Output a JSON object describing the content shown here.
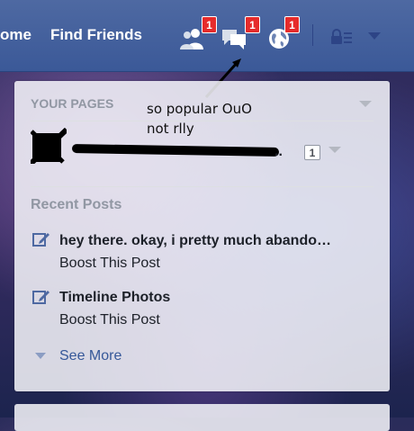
{
  "nav": {
    "home_label": "ome",
    "find_friends_label": "Find Friends",
    "friend_requests_badge": "1",
    "messages_badge": "1",
    "notifications_badge": "1"
  },
  "annotation": {
    "line1": "so popular OuO",
    "line2": "not rlly"
  },
  "your_pages": {
    "header": "YOUR PAGES",
    "page_name": "..",
    "page_count": "1"
  },
  "recent_posts": {
    "header": "Recent Posts",
    "posts": [
      {
        "title": "hey there. okay, i pretty much abando…",
        "action": "Boost This Post"
      },
      {
        "title": "Timeline Photos",
        "action": "Boost This Post"
      }
    ],
    "see_more": "See More"
  }
}
